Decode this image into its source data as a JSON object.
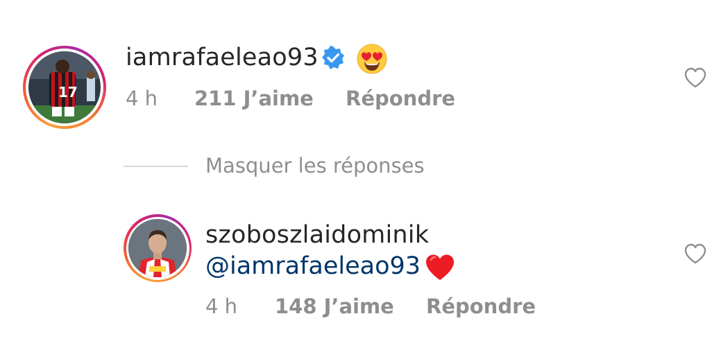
{
  "comment": {
    "username": "iamrafaeleao93",
    "verified_icon": "verified-badge-icon",
    "emoji_icon": "heart-eyes-emoji-icon",
    "time": "4 h",
    "likes": "211 J’aime",
    "reply_label": "Répondre",
    "like_icon": "heart-outline-icon"
  },
  "thread": {
    "hide_replies_label": "Masquer les réponses"
  },
  "reply": {
    "username": "szoboszlaidominik",
    "mention": "@iamrafaeleao93",
    "emoji_icon": "red-heart-emoji-icon",
    "time": "4 h",
    "likes": "148 J’aime",
    "reply_label": "Répondre",
    "like_icon": "heart-outline-icon"
  },
  "colors": {
    "text_primary": "#262626",
    "text_secondary": "#8e8e8e",
    "mention": "#003569",
    "verified_blue": "#3897f0",
    "red_heart": "#ed1c24"
  }
}
